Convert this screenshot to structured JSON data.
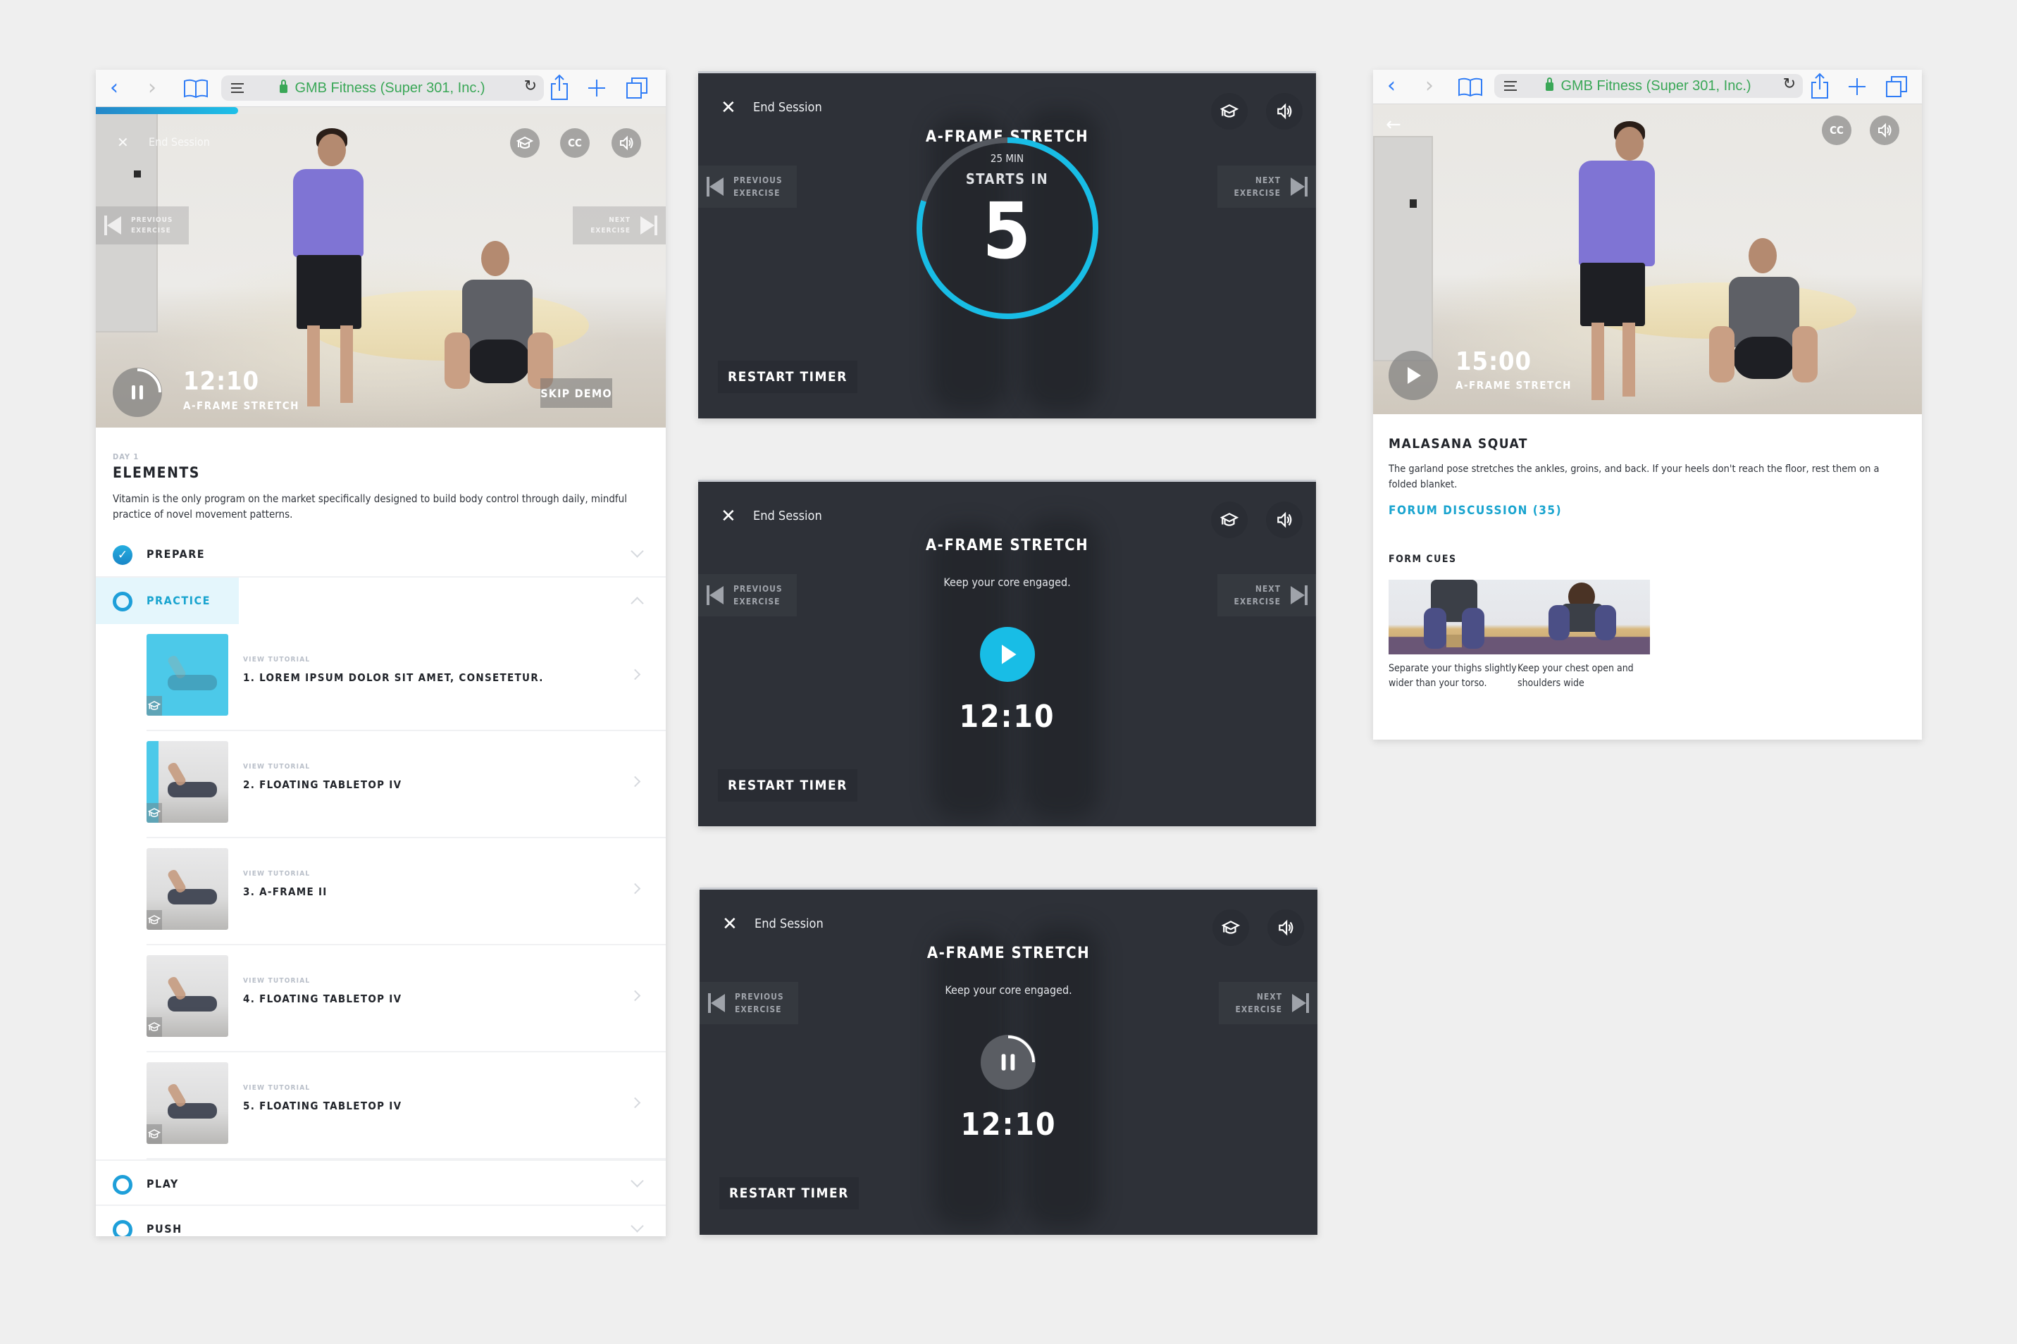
{
  "browser": {
    "url_label": "GMB Fitness (Super 301, Inc.)",
    "icons": [
      "back-icon",
      "forward-icon",
      "bookmarks-icon",
      "reader-icon",
      "lock-icon",
      "reload-icon",
      "share-icon",
      "new-tab-icon",
      "tabs-icon"
    ]
  },
  "colors": {
    "accent": "#19a4cf",
    "accent_bright": "#18bde6",
    "url_green": "#3aa757",
    "dark_bg": "#2e3138",
    "page_bg": "#efefef"
  },
  "left_panel": {
    "session_progress": 0.25,
    "video": {
      "end_session_label": "End Session",
      "cc_label": "CC",
      "previous_label": [
        "PREVIOUS",
        "EXERCISE"
      ],
      "next_label": [
        "NEXT",
        "EXERCISE"
      ],
      "timer": "12:10",
      "timer_progress": 0.25,
      "exercise_name": "A-FRAME STRETCH",
      "skip_label": "SKIP DEMO"
    },
    "day_label": "DAY 1",
    "title": "ELEMENTS",
    "description": "Vitamin is the only program on the market specifically designed to build body control through daily, mindful practice of novel movement patterns.",
    "sections": [
      {
        "label": "PREPARE",
        "state": "complete",
        "expanded": false
      },
      {
        "label": "PRACTICE",
        "state": "active",
        "expanded": true
      },
      {
        "label": "PLAY",
        "state": "incomplete",
        "expanded": false
      },
      {
        "label": "PUSH",
        "state": "incomplete",
        "expanded": false
      }
    ],
    "exercises": [
      {
        "tutorial_label": "VIEW TUTORIAL",
        "name": "1. LOREM IPSUM DOLOR SIT AMET, CONSETETUR.",
        "progress": 1.0
      },
      {
        "tutorial_label": "VIEW TUTORIAL",
        "name": "2. FLOATING TABLETOP IV",
        "progress": 0.15
      },
      {
        "tutorial_label": "VIEW TUTORIAL",
        "name": "3. A-FRAME II",
        "progress": 0
      },
      {
        "tutorial_label": "VIEW TUTORIAL",
        "name": "4. FLOATING TABLETOP IV",
        "progress": 0
      },
      {
        "tutorial_label": "VIEW TUTORIAL",
        "name": "5. FLOATING TABLETOP IV",
        "progress": 0
      }
    ]
  },
  "countdown_panel": {
    "end_session_label": "End Session",
    "title": "A-FRAME STRETCH",
    "duration": "25 MIN",
    "starts_in_label": "STARTS IN",
    "countdown_value": "5",
    "countdown_progress": 0.8,
    "previous_label": [
      "PREVIOUS",
      "EXERCISE"
    ],
    "next_label": [
      "NEXT",
      "EXERCISE"
    ],
    "restart_label": "RESTART TIMER"
  },
  "paused_panel": {
    "end_session_label": "End Session",
    "title": "A-FRAME STRETCH",
    "cue": "Keep your core engaged.",
    "timer": "12:10",
    "previous_label": [
      "PREVIOUS",
      "EXERCISE"
    ],
    "next_label": [
      "NEXT",
      "EXERCISE"
    ],
    "restart_label": "RESTART TIMER"
  },
  "playing_panel": {
    "end_session_label": "End Session",
    "title": "A-FRAME STRETCH",
    "cue": "Keep your core engaged.",
    "timer": "12:10",
    "timer_progress": 0.25,
    "previous_label": [
      "PREVIOUS",
      "EXERCISE"
    ],
    "next_label": [
      "NEXT",
      "EXERCISE"
    ],
    "restart_label": "RESTART TIMER"
  },
  "right_panel": {
    "video": {
      "cc_label": "CC",
      "timer": "15:00",
      "exercise_name": "A-FRAME STRETCH"
    },
    "title": "MALASANA SQUAT",
    "description": "The garland pose stretches the ankles, groins, and back. If your heels don't reach the floor, rest them on a folded blanket.",
    "forum_link": "FORUM DISCUSSION (35)",
    "form_cues_heading": "FORM CUES",
    "form_cues": [
      {
        "caption": "Separate your thighs slightly wider than your torso."
      },
      {
        "caption": "Keep your chest open and shoulders wide"
      }
    ]
  }
}
